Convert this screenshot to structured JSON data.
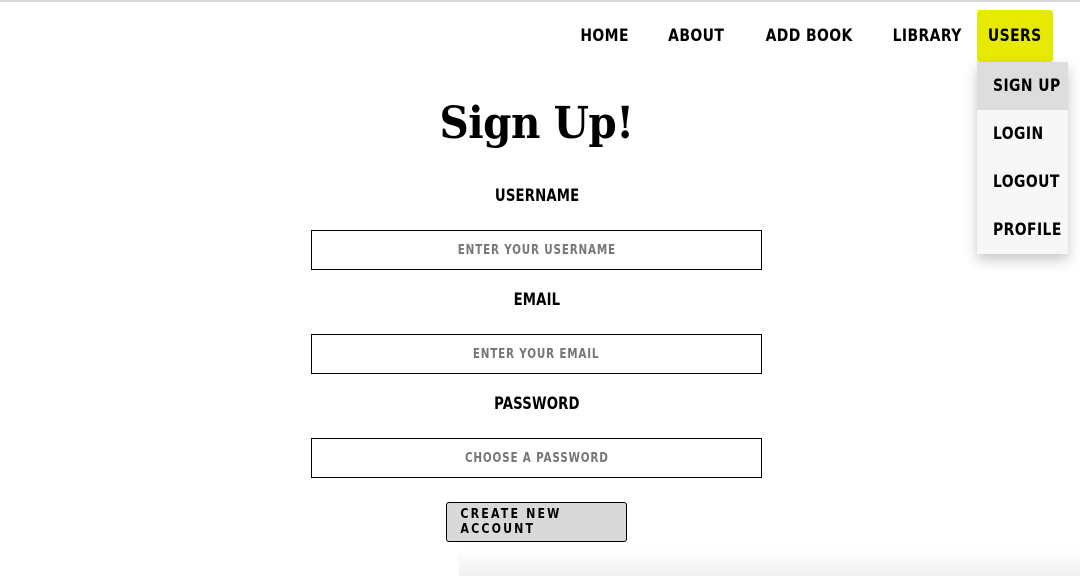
{
  "nav": {
    "home": "HOME",
    "about": "ABOUT",
    "add_book": "ADD BOOK",
    "library": "LIBRARY",
    "users": "USERS",
    "active_color": "#e6ea00"
  },
  "users_menu": {
    "items": [
      "SIGN UP",
      "LOGIN",
      "LOGOUT",
      "PROFILE"
    ],
    "active_item": "SIGN UP"
  },
  "form": {
    "title": "Sign Up!",
    "username": {
      "label": "USERNAME",
      "placeholder": "ENTER YOUR USERNAME",
      "value": ""
    },
    "email": {
      "label": "EMAIL",
      "placeholder": "ENTER YOUR EMAIL",
      "value": ""
    },
    "password": {
      "label": "PASSWORD",
      "placeholder": "CHOOSE A PASSWORD",
      "value": ""
    },
    "submit_label": "CREATE NEW ACCOUNT"
  }
}
